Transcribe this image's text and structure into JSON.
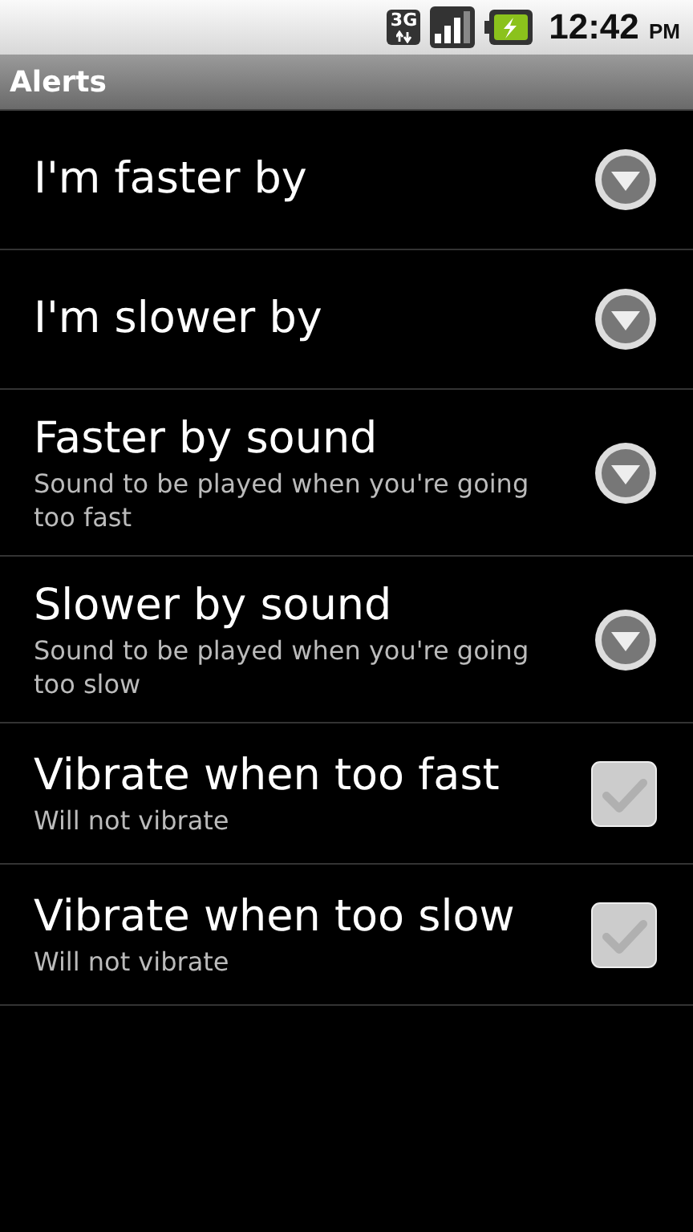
{
  "status_bar": {
    "network_type": "3G",
    "time": "12:42",
    "meridiem": "PM"
  },
  "title_bar": {
    "title": "Alerts"
  },
  "preferences": [
    {
      "kind": "dropdown",
      "title": "I'm faster by"
    },
    {
      "kind": "dropdown",
      "title": "I'm slower by"
    },
    {
      "kind": "dropdown",
      "title": "Faster by sound",
      "summary": "Sound to be played when you're going too fast"
    },
    {
      "kind": "dropdown",
      "title": "Slower by sound",
      "summary": "Sound to be played when you're going too slow"
    },
    {
      "kind": "checkbox",
      "title": "Vibrate when too fast",
      "summary": "Will not vibrate",
      "checked": false
    },
    {
      "kind": "checkbox",
      "title": "Vibrate when too slow",
      "summary": "Will not vibrate",
      "checked": false
    }
  ]
}
